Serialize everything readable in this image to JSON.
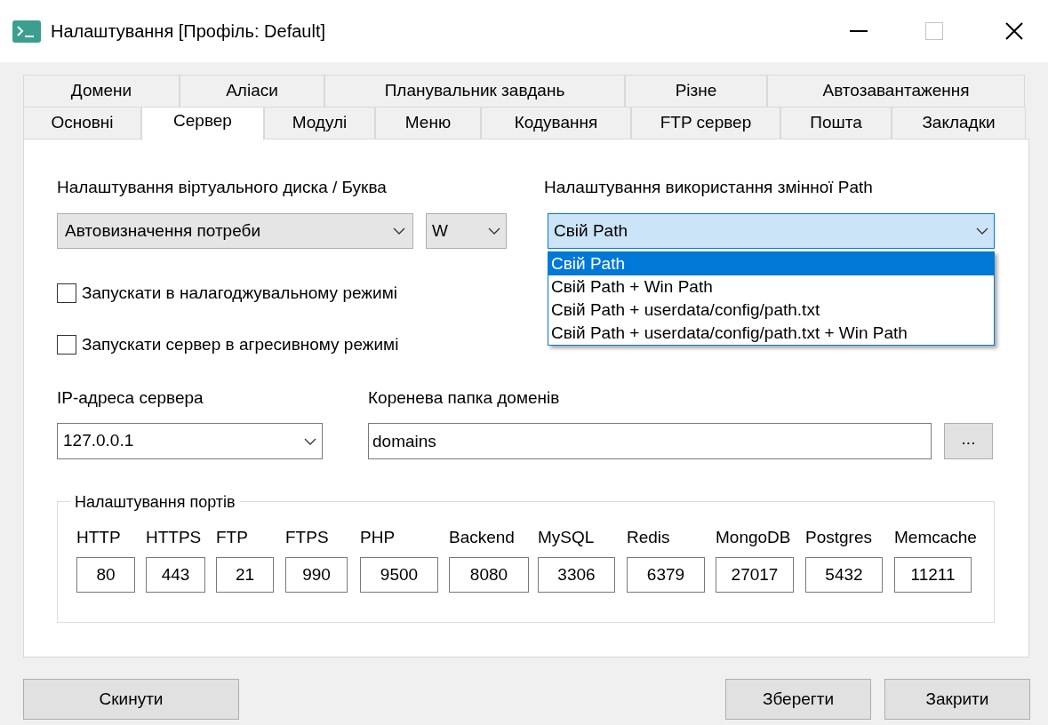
{
  "window": {
    "title": "Налаштування [Профіль: Default]"
  },
  "tab_rows": [
    {
      "tabs": [
        {
          "label": "Домени",
          "selected": false
        },
        {
          "label": "Аліаси",
          "selected": false
        },
        {
          "label": "Планувальник завдань",
          "selected": false
        },
        {
          "label": "Різне",
          "selected": false
        },
        {
          "label": "Автозавантаження",
          "selected": false
        }
      ]
    },
    {
      "tabs": [
        {
          "label": "Основні",
          "selected": false
        },
        {
          "label": "Сервер",
          "selected": true
        },
        {
          "label": "Модулі",
          "selected": false
        },
        {
          "label": "Меню",
          "selected": false
        },
        {
          "label": "Кодування",
          "selected": false
        },
        {
          "label": "FTP сервер",
          "selected": false
        },
        {
          "label": "Пошта",
          "selected": false
        },
        {
          "label": "Закладки",
          "selected": false
        }
      ]
    }
  ],
  "virtual_disk": {
    "label": "Налаштування віртуального диска / Буква",
    "mode": "Автовизначення потреби",
    "letter": "W"
  },
  "path_setting": {
    "label": "Налаштування використання змінної Path",
    "value": "Свій Path",
    "expanded": true,
    "options": [
      {
        "label": "Свій Path",
        "selected": true
      },
      {
        "label": "Свій Path + Win Path",
        "selected": false
      },
      {
        "label": "Свій Path + userdata/config/path.txt",
        "selected": false
      },
      {
        "label": "Свій Path + userdata/config/path.txt + Win Path",
        "selected": false
      }
    ]
  },
  "checkboxes": [
    {
      "label": "Запускати в налагоджувальному режимі",
      "checked": false
    },
    {
      "label": "Запускати сервер в агресивному режимі",
      "checked": false
    }
  ],
  "server_ip": {
    "label": "IP-адреса сервера",
    "value": "127.0.0.1"
  },
  "domains_root": {
    "label": "Коренева папка доменів",
    "value": "domains",
    "browse_button": "..."
  },
  "ports": {
    "title": "Налаштування портів",
    "items": [
      {
        "label": "HTTP",
        "value": "80"
      },
      {
        "label": "HTTPS",
        "value": "443"
      },
      {
        "label": "FTP",
        "value": "21"
      },
      {
        "label": "FTPS",
        "value": "990"
      },
      {
        "label": "PHP",
        "value": "9500"
      },
      {
        "label": "Backend",
        "value": "8080"
      },
      {
        "label": "MySQL",
        "value": "3306"
      },
      {
        "label": "Redis",
        "value": "6379"
      },
      {
        "label": "MongoDB",
        "value": "27017"
      },
      {
        "label": "Postgres",
        "value": "5432"
      },
      {
        "label": "Memcache",
        "value": "11211"
      }
    ]
  },
  "reset_button": "Скинути",
  "buttons": [
    "Зберегти",
    "Закрити"
  ]
}
